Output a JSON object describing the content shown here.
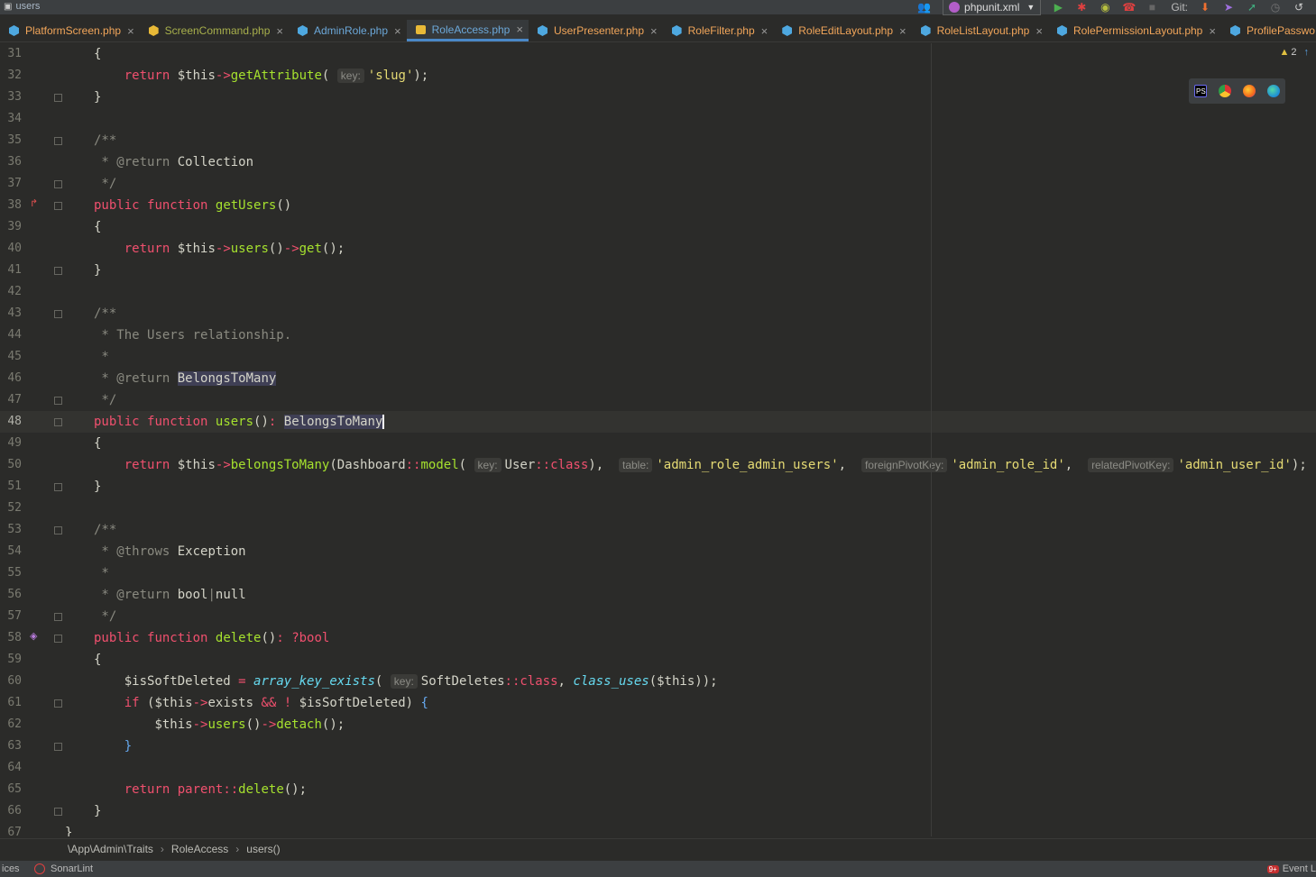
{
  "topbar": {
    "project": "users",
    "run_config": "phpunit.xml",
    "git_label": "Git:"
  },
  "tabs": [
    {
      "label": "PlatformScreen.php",
      "color": "orange"
    },
    {
      "label": "ScreenCommand.php",
      "color": "green"
    },
    {
      "label": "AdminRole.php",
      "color": "blue"
    },
    {
      "label": "RoleAccess.php",
      "color": "blue",
      "active": true
    },
    {
      "label": "UserPresenter.php",
      "color": "orange"
    },
    {
      "label": "RoleFilter.php",
      "color": "orange"
    },
    {
      "label": "RoleEditLayout.php",
      "color": "orange"
    },
    {
      "label": "RoleListLayout.php",
      "color": "orange"
    },
    {
      "label": "RolePermissionLayout.php",
      "color": "orange"
    },
    {
      "label": "ProfilePasswo",
      "color": "orange"
    }
  ],
  "warnings": {
    "count": "2"
  },
  "lines": [
    "31",
    "32",
    "33",
    "34",
    "35",
    "36",
    "37",
    "38",
    "39",
    "40",
    "41",
    "42",
    "43",
    "44",
    "45",
    "46",
    "47",
    "48",
    "49",
    "50",
    "51",
    "52",
    "53",
    "54",
    "55",
    "56",
    "57",
    "58",
    "59",
    "60",
    "61",
    "62",
    "63",
    "64",
    "65",
    "66",
    "67"
  ],
  "code": {
    "l32": {
      "t1": "return",
      "t2": "$this",
      "t3": "->",
      "t4": "getAttribute",
      "hint": "key:",
      "t5": "'slug'"
    },
    "l36": {
      "tag": "@return",
      "type": "Collection"
    },
    "l38": {
      "k1": "public",
      "k2": "function",
      "name": "getUsers"
    },
    "l40": {
      "t1": "return",
      "t2": "$this",
      "m1": "users",
      "m2": "get"
    },
    "l44": {
      "text": "The Users relationship."
    },
    "l46": {
      "tag": "@return",
      "type": "BelongsToMany"
    },
    "l48": {
      "k1": "public",
      "k2": "function",
      "name": "users",
      "ret": "BelongsToMany"
    },
    "l50": {
      "t1": "return",
      "t2": "$this",
      "m1": "belongsToMany",
      "c1": "Dashboard",
      "m2": "model",
      "h1": "key:",
      "c2": "User",
      "k3": "class",
      "h2": "table:",
      "s1": "'admin_role_admin_users'",
      "h3": "foreignPivotKey:",
      "s2": "'admin_role_id'",
      "h4": "relatedPivotKey:",
      "s3": "'admin_user_id'"
    },
    "l54": {
      "tag": "@throws",
      "type": "Exception"
    },
    "l56": {
      "tag": "@return",
      "t1": "bool",
      "t2": "null"
    },
    "l58": {
      "k1": "public",
      "k2": "function",
      "name": "delete",
      "ret": "?bool"
    },
    "l60": {
      "var": "$isSoftDeleted",
      "fn": "array_key_exists",
      "hint": "key:",
      "c1": "SoftDeletes",
      "k1": "class",
      "fn2": "class_uses",
      "this": "$this"
    },
    "l61": {
      "k1": "if",
      "this": "$this",
      "prop": "exists",
      "op": "&&",
      "bang": "!",
      "var": "$isSoftDeleted"
    },
    "l62": {
      "this": "$this",
      "m1": "users",
      "m2": "detach"
    },
    "l65": {
      "k1": "return",
      "k2": "parent",
      "m1": "delete"
    }
  },
  "breadcrumb": {
    "ns": "\\App\\Admin\\Traits",
    "trait": "RoleAccess",
    "method": "users()"
  },
  "statusbar": {
    "left": "ices",
    "sonarlint": "SonarLint",
    "event": "Event L",
    "badge": "9+"
  }
}
